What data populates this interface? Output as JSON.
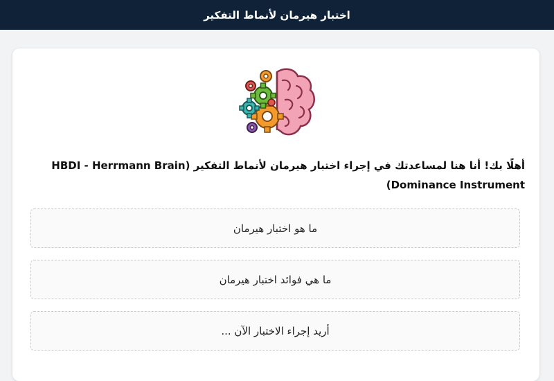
{
  "header": {
    "title": "اختبار هيرمان لأنماط التفكير"
  },
  "intro": {
    "logo_icon": "brain-gears-icon",
    "welcome_text": "أهلًا بك! أنا هنا لمساعدتك في إجراء اختبار هيرمان لأنماط التفكير (HBDI - Herrmann Brain Dominance Instrument)"
  },
  "options": [
    {
      "label": "ما هو اختبار هيرمان"
    },
    {
      "label": "ما هي فوائد اختبار هيرمان"
    },
    {
      "label": "أريد إجراء الاختبار الآن ..."
    }
  ],
  "colors": {
    "header_bg": "#0f2238",
    "brain_pink": "#f0a0b4",
    "gear_orange": "#f49a2c",
    "gear_green": "#6dbb3c",
    "gear_teal": "#3bb7b3",
    "gear_red": "#e0554f",
    "gear_purple": "#8a5aa8"
  }
}
